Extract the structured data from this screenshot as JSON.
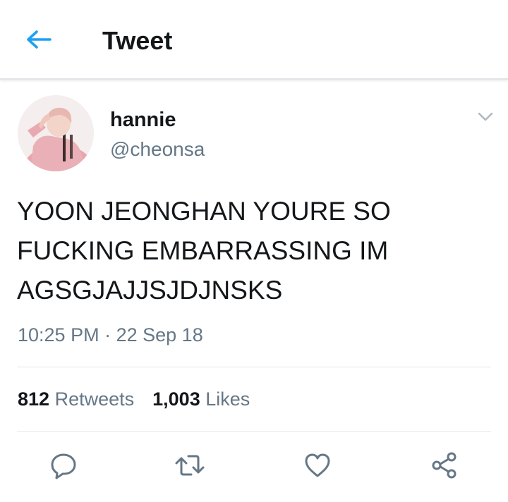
{
  "header": {
    "title": "Tweet",
    "back_icon": "arrow-left-icon",
    "accent_color": "#1da1f2"
  },
  "tweet": {
    "author": {
      "display_name": "hannie",
      "handle": "@cheonsa",
      "avatar": "profile-photo"
    },
    "menu_icon": "chevron-down-icon",
    "text": "YOON JEONGHAN YOURE SO\nFUCKING EMBARRASSING IM\nAGSGJAJJSJDJNSKS",
    "time": "10:25 PM",
    "separator": "·",
    "date": "22 Sep 18",
    "stats": {
      "retweets_count": "812",
      "retweets_label": "Retweets",
      "likes_count": "1,003",
      "likes_label": "Likes"
    },
    "actions": [
      {
        "icon": "reply-icon"
      },
      {
        "icon": "retweet-icon"
      },
      {
        "icon": "heart-icon"
      },
      {
        "icon": "share-icon"
      }
    ]
  },
  "colors": {
    "text_primary": "#14171a",
    "text_secondary": "#657786",
    "divider": "#e1e4e7"
  }
}
